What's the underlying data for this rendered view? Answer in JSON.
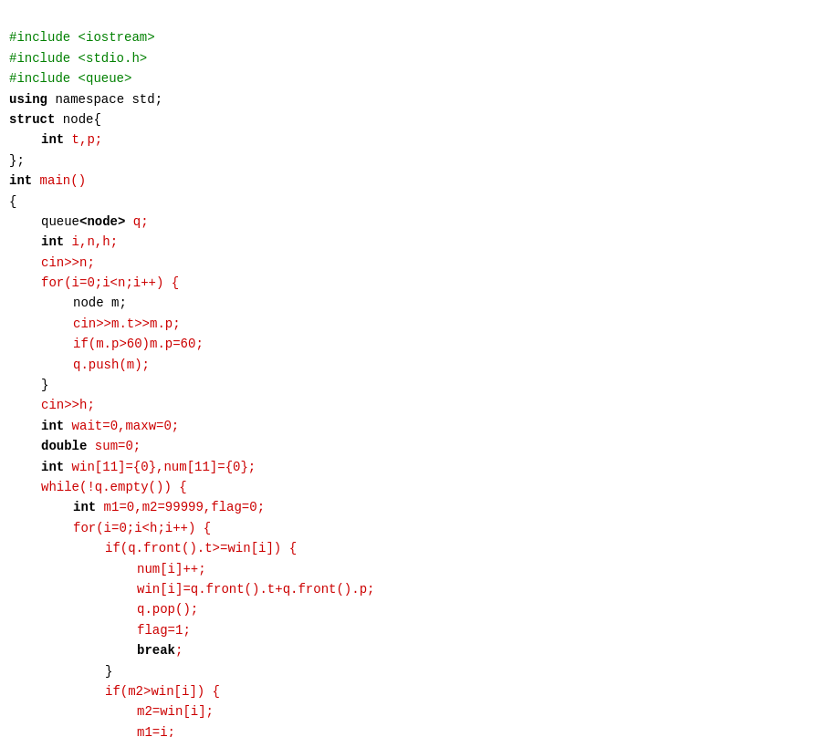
{
  "code": {
    "lines": [
      {
        "indent": 0,
        "parts": [
          {
            "text": "#include <iostream>",
            "color": "green"
          }
        ]
      },
      {
        "indent": 0,
        "parts": [
          {
            "text": "#include <stdio.h>",
            "color": "green"
          }
        ]
      },
      {
        "indent": 0,
        "parts": [
          {
            "text": "#include <queue>",
            "color": "green"
          }
        ]
      },
      {
        "indent": 0,
        "parts": [
          {
            "text": "using",
            "color": "black",
            "bold": true
          },
          {
            "text": " namespace std;",
            "color": "black"
          }
        ]
      },
      {
        "indent": 0,
        "parts": [
          {
            "text": "struct",
            "color": "black",
            "bold": true
          },
          {
            "text": " node{",
            "color": "black"
          }
        ]
      },
      {
        "indent": 1,
        "parts": [
          {
            "text": "int",
            "color": "black",
            "bold": true
          },
          {
            "text": " t,p;",
            "color": "red"
          }
        ]
      },
      {
        "indent": 0,
        "parts": [
          {
            "text": "};",
            "color": "black"
          }
        ]
      },
      {
        "indent": 0,
        "parts": [
          {
            "text": "int",
            "color": "black",
            "bold": true
          },
          {
            "text": " main()",
            "color": "red"
          }
        ]
      },
      {
        "indent": 0,
        "parts": [
          {
            "text": "{",
            "color": "black"
          }
        ]
      },
      {
        "indent": 1,
        "parts": [
          {
            "text": "queue",
            "color": "black"
          },
          {
            "text": "<node>",
            "color": "black",
            "bold": true
          },
          {
            "text": " q;",
            "color": "red"
          }
        ]
      },
      {
        "indent": 1,
        "parts": [
          {
            "text": "int",
            "color": "black",
            "bold": true
          },
          {
            "text": " i,n,h;",
            "color": "red"
          }
        ]
      },
      {
        "indent": 1,
        "parts": [
          {
            "text": "cin>>n;",
            "color": "red"
          }
        ]
      },
      {
        "indent": 1,
        "parts": [
          {
            "text": "for(i=0;i<n;i++) {",
            "color": "red"
          }
        ]
      },
      {
        "indent": 2,
        "parts": [
          {
            "text": "node m;",
            "color": "black"
          }
        ]
      },
      {
        "indent": 2,
        "parts": [
          {
            "text": "cin>>m.t>>m.p;",
            "color": "red"
          }
        ]
      },
      {
        "indent": 2,
        "parts": [
          {
            "text": "if(m.p>60)m.p=60;",
            "color": "red"
          }
        ]
      },
      {
        "indent": 2,
        "parts": [
          {
            "text": "q.push(m);",
            "color": "red"
          }
        ]
      },
      {
        "indent": 1,
        "parts": [
          {
            "text": "}",
            "color": "black"
          }
        ]
      },
      {
        "indent": 1,
        "parts": [
          {
            "text": "cin>>h;",
            "color": "red"
          }
        ]
      },
      {
        "indent": 1,
        "parts": [
          {
            "text": "int",
            "color": "black",
            "bold": true
          },
          {
            "text": " wait=0,maxw=0;",
            "color": "red"
          }
        ]
      },
      {
        "indent": 1,
        "parts": [
          {
            "text": "double",
            "color": "black",
            "bold": true
          },
          {
            "text": " sum=0;",
            "color": "red"
          }
        ]
      },
      {
        "indent": 1,
        "parts": [
          {
            "text": "int",
            "color": "black",
            "bold": true
          },
          {
            "text": " win[11]={0},num[11]={0};",
            "color": "red"
          }
        ]
      },
      {
        "indent": 1,
        "parts": [
          {
            "text": "while(!q.empty()) {",
            "color": "red"
          }
        ]
      },
      {
        "indent": 2,
        "parts": [
          {
            "text": "int",
            "color": "black",
            "bold": true
          },
          {
            "text": " m1=0,m2=99999,flag=0;",
            "color": "red"
          }
        ]
      },
      {
        "indent": 2,
        "parts": [
          {
            "text": "for(i=0;i<h;i++) {",
            "color": "red"
          }
        ]
      },
      {
        "indent": 3,
        "parts": [
          {
            "text": "if(q.front().t>=win[i]) {",
            "color": "red"
          }
        ]
      },
      {
        "indent": 4,
        "parts": [
          {
            "text": "num[i]++;",
            "color": "red"
          }
        ]
      },
      {
        "indent": 4,
        "parts": [
          {
            "text": "win[i]=q.front().t+q.front().p;",
            "color": "red"
          }
        ]
      },
      {
        "indent": 4,
        "parts": [
          {
            "text": "q.pop();",
            "color": "red"
          }
        ]
      },
      {
        "indent": 4,
        "parts": [
          {
            "text": "flag=1;",
            "color": "red"
          }
        ]
      },
      {
        "indent": 4,
        "parts": [
          {
            "text": "break",
            "color": "black",
            "bold": true
          },
          {
            "text": ";",
            "color": "red"
          }
        ]
      },
      {
        "indent": 3,
        "parts": [
          {
            "text": "}",
            "color": "black"
          }
        ]
      },
      {
        "indent": 3,
        "parts": [
          {
            "text": "if(m2>win[i]) {",
            "color": "red"
          }
        ]
      },
      {
        "indent": 4,
        "parts": [
          {
            "text": "m2=win[i];",
            "color": "red"
          }
        ]
      },
      {
        "indent": 4,
        "parts": [
          {
            "text": "m1=i;",
            "color": "red"
          }
        ]
      },
      {
        "indent": 3,
        "parts": [
          {
            "text": "}",
            "color": "black"
          }
        ]
      }
    ]
  }
}
